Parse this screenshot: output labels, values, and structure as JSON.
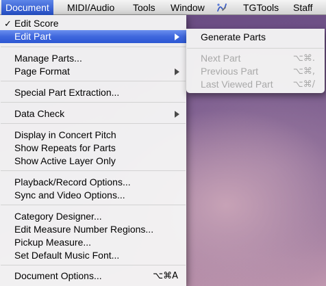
{
  "menubar": {
    "items": [
      {
        "label": "Document",
        "active": true
      },
      {
        "label": "MIDI/Audio"
      },
      {
        "label": "Tools"
      },
      {
        "label": "Window"
      },
      {
        "icon": "script-icon"
      },
      {
        "label": "TGTools"
      },
      {
        "label": "Staff"
      }
    ]
  },
  "document_menu": {
    "items": [
      {
        "label": "Edit Score",
        "checked": true
      },
      {
        "label": "Edit Part",
        "highlighted": true,
        "submenu": true
      },
      {
        "label": "Manage Parts..."
      },
      {
        "label": "Page Format",
        "submenu": true
      },
      {
        "label": "Special Part Extraction..."
      },
      {
        "label": "Data Check",
        "submenu": true
      },
      {
        "label": "Display in Concert Pitch"
      },
      {
        "label": "Show Repeats for Parts"
      },
      {
        "label": "Show Active Layer Only"
      },
      {
        "label": "Playback/Record Options..."
      },
      {
        "label": "Sync and Video Options..."
      },
      {
        "label": "Category Designer..."
      },
      {
        "label": "Edit Measure Number Regions..."
      },
      {
        "label": "Pickup Measure..."
      },
      {
        "label": "Set Default Music Font..."
      },
      {
        "label": "Document Options...",
        "shortcut": "⌥⌘A"
      }
    ],
    "check_mark": "✓"
  },
  "edit_part_submenu": {
    "items": [
      {
        "label": "Generate Parts",
        "enabled": true
      },
      {
        "label": "Next Part",
        "shortcut": "⌥⌘.",
        "enabled": false
      },
      {
        "label": "Previous Part",
        "shortcut": "⌥⌘,",
        "enabled": false
      },
      {
        "label": "Last Viewed Part",
        "shortcut": "⌥⌘/",
        "enabled": false
      }
    ]
  },
  "colors": {
    "highlight": "#3f67dd",
    "disabled_text": "#a8a8a8",
    "menu_bg": "#f4f4f4"
  }
}
